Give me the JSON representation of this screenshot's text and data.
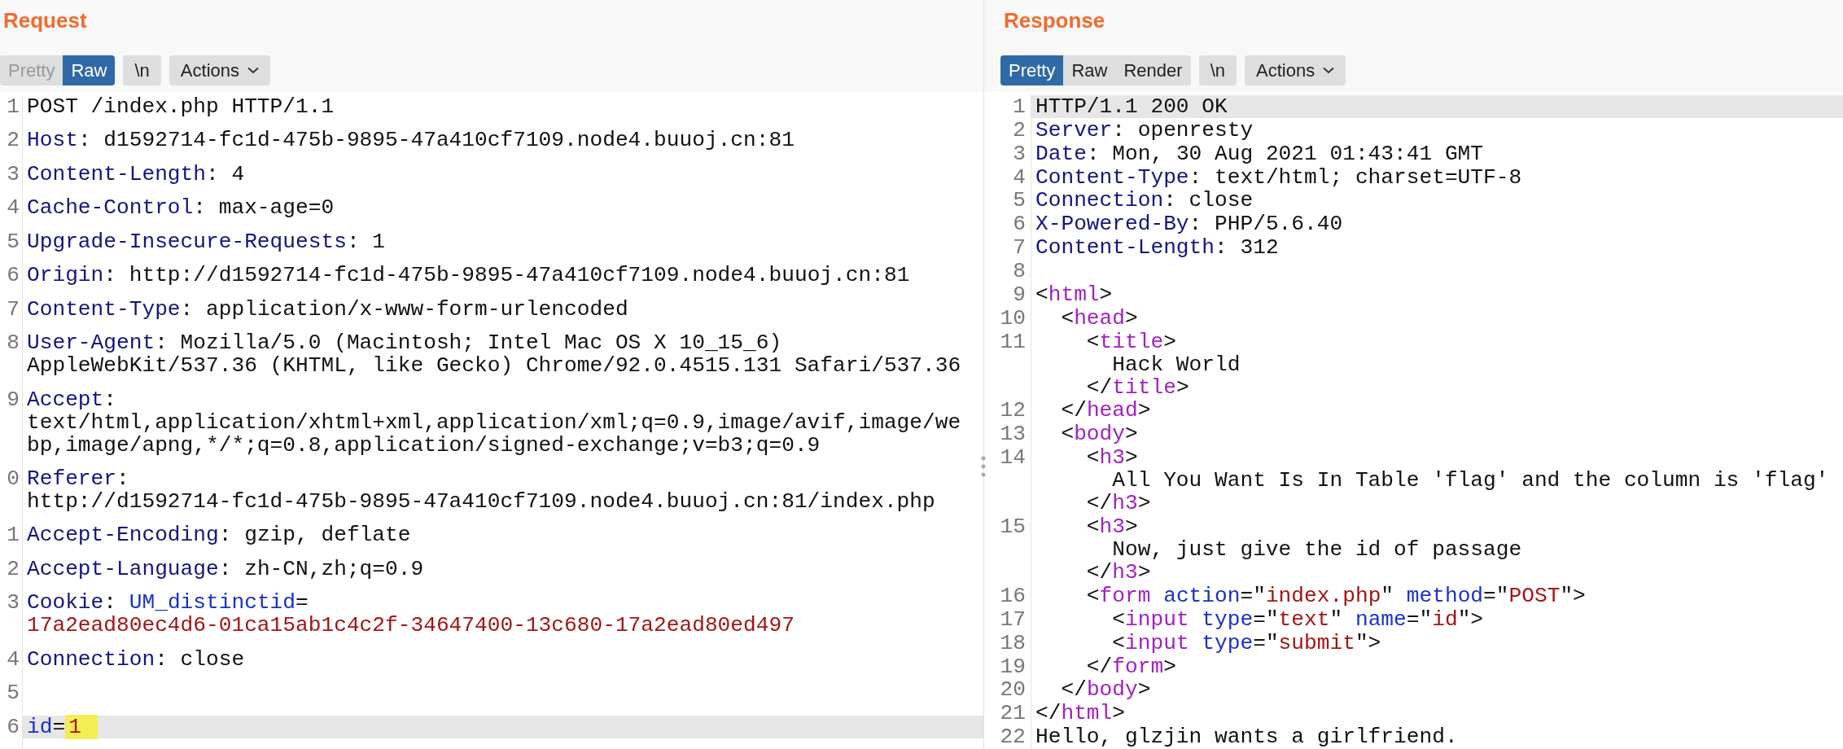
{
  "panels": [
    {
      "title": "Request",
      "view_tabs": [
        {
          "label": "Pretty",
          "selected": false
        },
        {
          "label": "Raw",
          "selected": true
        }
      ],
      "newline_button": "\\n",
      "actions_button": "Actions",
      "lines": [
        {
          "number": "1",
          "current": false,
          "rows": [
            {
              "tokens": [
                {
                  "kind": "plain",
                  "text": "POST /index.php HTTP/1.1"
                }
              ]
            }
          ]
        },
        {
          "number": "2",
          "current": false,
          "rows": [
            {
              "tokens": [
                {
                  "kind": "key",
                  "text": "Host"
                },
                {
                  "kind": "plain",
                  "text": ": d1592714-fc1d-475b-9895-47a410cf7109.node4.buuoj.cn:81"
                }
              ]
            }
          ]
        },
        {
          "number": "3",
          "current": false,
          "rows": [
            {
              "tokens": [
                {
                  "kind": "key",
                  "text": "Content-Length"
                },
                {
                  "kind": "plain",
                  "text": ": 4"
                }
              ]
            }
          ]
        },
        {
          "number": "4",
          "current": false,
          "rows": [
            {
              "tokens": [
                {
                  "kind": "key",
                  "text": "Cache-Control"
                },
                {
                  "kind": "plain",
                  "text": ": max-age=0"
                }
              ]
            }
          ]
        },
        {
          "number": "5",
          "current": false,
          "rows": [
            {
              "tokens": [
                {
                  "kind": "key",
                  "text": "Upgrade-Insecure-Requests"
                },
                {
                  "kind": "plain",
                  "text": ": 1"
                }
              ]
            }
          ]
        },
        {
          "number": "6",
          "current": false,
          "rows": [
            {
              "tokens": [
                {
                  "kind": "key",
                  "text": "Origin"
                },
                {
                  "kind": "plain",
                  "text": ": http://d1592714-fc1d-475b-9895-47a410cf7109.node4.buuoj.cn:81"
                }
              ]
            }
          ]
        },
        {
          "number": "7",
          "current": false,
          "rows": [
            {
              "tokens": [
                {
                  "kind": "key",
                  "text": "Content-Type"
                },
                {
                  "kind": "plain",
                  "text": ": application/x-www-form-urlencoded"
                }
              ]
            }
          ]
        },
        {
          "number": "8",
          "current": false,
          "rows": [
            {
              "tokens": [
                {
                  "kind": "key",
                  "text": "User-Agent"
                },
                {
                  "kind": "plain",
                  "text": ": Mozilla/5.0 (Macintosh; Intel Mac OS X 10_15_6)"
                }
              ]
            },
            {
              "tokens": [
                {
                  "kind": "plain",
                  "text": "AppleWebKit/537.36 (KHTML, like Gecko) Chrome/92.0.4515.131 Safari/537.36"
                }
              ]
            }
          ]
        },
        {
          "number": "9",
          "current": false,
          "rows": [
            {
              "tokens": [
                {
                  "kind": "key",
                  "text": "Accept"
                },
                {
                  "kind": "plain",
                  "text": ":"
                }
              ]
            },
            {
              "tokens": [
                {
                  "kind": "plain",
                  "text": "text/html,application/xhtml+xml,application/xml;q=0.9,image/avif,image/we"
                }
              ]
            },
            {
              "tokens": [
                {
                  "kind": "plain",
                  "text": "bp,image/apng,*/*;q=0.8,application/signed-exchange;v=b3;q=0.9"
                }
              ]
            }
          ]
        },
        {
          "number": "0",
          "current": false,
          "rows": [
            {
              "tokens": [
                {
                  "kind": "key",
                  "text": "Referer"
                },
                {
                  "kind": "plain",
                  "text": ":"
                }
              ]
            },
            {
              "tokens": [
                {
                  "kind": "plain",
                  "text": "http://d1592714-fc1d-475b-9895-47a410cf7109.node4.buuoj.cn:81/index.php"
                }
              ]
            }
          ]
        },
        {
          "number": "1",
          "current": false,
          "rows": [
            {
              "tokens": [
                {
                  "kind": "key",
                  "text": "Accept-Encoding"
                },
                {
                  "kind": "plain",
                  "text": ": gzip, deflate"
                }
              ]
            }
          ]
        },
        {
          "number": "2",
          "current": false,
          "rows": [
            {
              "tokens": [
                {
                  "kind": "key",
                  "text": "Accept-Language"
                },
                {
                  "kind": "plain",
                  "text": ": zh-CN,zh;q=0.9"
                }
              ]
            }
          ]
        },
        {
          "number": "3",
          "current": false,
          "rows": [
            {
              "tokens": [
                {
                  "kind": "key",
                  "text": "Cookie"
                },
                {
                  "kind": "plain",
                  "text": ": "
                },
                {
                  "kind": "attr",
                  "text": "UM_distinctid"
                },
                {
                  "kind": "plain",
                  "text": "="
                }
              ]
            },
            {
              "tokens": [
                {
                  "kind": "string",
                  "text": "17a2ead80ec4d6-01ca15ab1c4c2f-34647400-13c680-17a2ead80ed497"
                }
              ]
            }
          ]
        },
        {
          "number": "4",
          "current": false,
          "rows": [
            {
              "tokens": [
                {
                  "kind": "key",
                  "text": "Connection"
                },
                {
                  "kind": "plain",
                  "text": ": close"
                }
              ]
            }
          ]
        },
        {
          "number": "5",
          "current": false,
          "rows": [
            {}
          ]
        },
        {
          "number": "6",
          "current": true,
          "rows": [
            {
              "tokens": [
                {
                  "kind": "attr",
                  "text": "id"
                },
                {
                  "kind": "plain",
                  "text": "="
                },
                {
                  "kind": "string",
                  "text": "1",
                  "highlighted": true
                }
              ]
            }
          ]
        }
      ]
    },
    {
      "title": "Response",
      "view_tabs": [
        {
          "label": "Pretty",
          "selected": true
        },
        {
          "label": "Raw",
          "selected": false
        },
        {
          "label": "Render",
          "selected": false
        }
      ],
      "newline_button": "\\n",
      "actions_button": "Actions",
      "lines": [
        {
          "number": "1",
          "current": true,
          "rows": [
            {
              "tokens": [
                {
                  "kind": "plain",
                  "text": "HTTP/1.1 200 OK"
                }
              ]
            }
          ]
        },
        {
          "number": "2",
          "current": false,
          "rows": [
            {
              "tokens": [
                {
                  "kind": "key",
                  "text": "Server"
                },
                {
                  "kind": "plain",
                  "text": ": openresty"
                }
              ]
            }
          ]
        },
        {
          "number": "3",
          "current": false,
          "rows": [
            {
              "tokens": [
                {
                  "kind": "key",
                  "text": "Date"
                },
                {
                  "kind": "plain",
                  "text": ": Mon, 30 Aug 2021 01:43:41 GMT"
                }
              ]
            }
          ]
        },
        {
          "number": "4",
          "current": false,
          "rows": [
            {
              "tokens": [
                {
                  "kind": "key",
                  "text": "Content-Type"
                },
                {
                  "kind": "plain",
                  "text": ": text/html; charset=UTF-8"
                }
              ]
            }
          ]
        },
        {
          "number": "5",
          "current": false,
          "rows": [
            {
              "tokens": [
                {
                  "kind": "key",
                  "text": "Connection"
                },
                {
                  "kind": "plain",
                  "text": ": close"
                }
              ]
            }
          ]
        },
        {
          "number": "6",
          "current": false,
          "rows": [
            {
              "tokens": [
                {
                  "kind": "key",
                  "text": "X-Powered-By"
                },
                {
                  "kind": "plain",
                  "text": ": PHP/5.6.40"
                }
              ]
            }
          ]
        },
        {
          "number": "7",
          "current": false,
          "rows": [
            {
              "tokens": [
                {
                  "kind": "key",
                  "text": "Content-Length"
                },
                {
                  "kind": "plain",
                  "text": ": 312"
                }
              ]
            }
          ]
        },
        {
          "number": "8",
          "current": false,
          "rows": [
            {}
          ]
        },
        {
          "number": "9",
          "current": false,
          "rows": [
            {
              "tokens": [
                {
                  "kind": "plain",
                  "text": "<"
                },
                {
                  "kind": "tag",
                  "text": "html"
                },
                {
                  "kind": "plain",
                  "text": ">"
                }
              ]
            }
          ]
        },
        {
          "number": "10",
          "current": false,
          "rows": [
            {
              "tokens": [
                {
                  "kind": "plain",
                  "text": "  <"
                },
                {
                  "kind": "tag",
                  "text": "head"
                },
                {
                  "kind": "plain",
                  "text": ">"
                }
              ]
            }
          ]
        },
        {
          "number": "11",
          "current": false,
          "rows": [
            {
              "tokens": [
                {
                  "kind": "plain",
                  "text": "    <"
                },
                {
                  "kind": "tag",
                  "text": "title"
                },
                {
                  "kind": "plain",
                  "text": ">"
                }
              ]
            },
            {
              "tokens": [
                {
                  "kind": "plain",
                  "text": "      Hack World"
                }
              ]
            },
            {
              "tokens": [
                {
                  "kind": "plain",
                  "text": "    </"
                },
                {
                  "kind": "tag",
                  "text": "title"
                },
                {
                  "kind": "plain",
                  "text": ">"
                }
              ]
            }
          ]
        },
        {
          "number": "12",
          "current": false,
          "rows": [
            {
              "tokens": [
                {
                  "kind": "plain",
                  "text": "  </"
                },
                {
                  "kind": "tag",
                  "text": "head"
                },
                {
                  "kind": "plain",
                  "text": ">"
                }
              ]
            }
          ]
        },
        {
          "number": "13",
          "current": false,
          "rows": [
            {
              "tokens": [
                {
                  "kind": "plain",
                  "text": "  <"
                },
                {
                  "kind": "tag",
                  "text": "body"
                },
                {
                  "kind": "plain",
                  "text": ">"
                }
              ]
            }
          ]
        },
        {
          "number": "14",
          "current": false,
          "rows": [
            {
              "tokens": [
                {
                  "kind": "plain",
                  "text": "    <"
                },
                {
                  "kind": "tag",
                  "text": "h3"
                },
                {
                  "kind": "plain",
                  "text": ">"
                }
              ]
            },
            {
              "tokens": [
                {
                  "kind": "plain",
                  "text": "      All You Want Is In Table 'flag' and the column is 'flag'"
                }
              ]
            },
            {
              "tokens": [
                {
                  "kind": "plain",
                  "text": "    </"
                },
                {
                  "kind": "tag",
                  "text": "h3"
                },
                {
                  "kind": "plain",
                  "text": ">"
                }
              ]
            }
          ]
        },
        {
          "number": "15",
          "current": false,
          "rows": [
            {
              "tokens": [
                {
                  "kind": "plain",
                  "text": "    <"
                },
                {
                  "kind": "tag",
                  "text": "h3"
                },
                {
                  "kind": "plain",
                  "text": ">"
                }
              ]
            },
            {
              "tokens": [
                {
                  "kind": "plain",
                  "text": "      Now, just give the id of passage"
                }
              ]
            },
            {
              "tokens": [
                {
                  "kind": "plain",
                  "text": "    </"
                },
                {
                  "kind": "tag",
                  "text": "h3"
                },
                {
                  "kind": "plain",
                  "text": ">"
                }
              ]
            }
          ]
        },
        {
          "number": "16",
          "current": false,
          "rows": [
            {
              "tokens": [
                {
                  "kind": "plain",
                  "text": "    <"
                },
                {
                  "kind": "tag",
                  "text": "form"
                },
                {
                  "kind": "attr",
                  "text": " action"
                },
                {
                  "kind": "plain",
                  "text": "=\""
                },
                {
                  "kind": "string",
                  "text": "index.php"
                },
                {
                  "kind": "plain",
                  "text": "\""
                },
                {
                  "kind": "attr",
                  "text": " method"
                },
                {
                  "kind": "plain",
                  "text": "=\""
                },
                {
                  "kind": "string",
                  "text": "POST"
                },
                {
                  "kind": "plain",
                  "text": "\">"
                }
              ]
            }
          ]
        },
        {
          "number": "17",
          "current": false,
          "rows": [
            {
              "tokens": [
                {
                  "kind": "plain",
                  "text": "      <"
                },
                {
                  "kind": "tag",
                  "text": "input"
                },
                {
                  "kind": "attr",
                  "text": " type"
                },
                {
                  "kind": "plain",
                  "text": "=\""
                },
                {
                  "kind": "string",
                  "text": "text"
                },
                {
                  "kind": "plain",
                  "text": "\""
                },
                {
                  "kind": "attr",
                  "text": " name"
                },
                {
                  "kind": "plain",
                  "text": "=\""
                },
                {
                  "kind": "string",
                  "text": "id"
                },
                {
                  "kind": "plain",
                  "text": "\">"
                }
              ]
            }
          ]
        },
        {
          "number": "18",
          "current": false,
          "rows": [
            {
              "tokens": [
                {
                  "kind": "plain",
                  "text": "      <"
                },
                {
                  "kind": "tag",
                  "text": "input"
                },
                {
                  "kind": "attr",
                  "text": " type"
                },
                {
                  "kind": "plain",
                  "text": "=\""
                },
                {
                  "kind": "string",
                  "text": "submit"
                },
                {
                  "kind": "plain",
                  "text": "\">"
                }
              ]
            }
          ]
        },
        {
          "number": "19",
          "current": false,
          "rows": [
            {
              "tokens": [
                {
                  "kind": "plain",
                  "text": "    </"
                },
                {
                  "kind": "tag",
                  "text": "form"
                },
                {
                  "kind": "plain",
                  "text": ">"
                }
              ]
            }
          ]
        },
        {
          "number": "20",
          "current": false,
          "rows": [
            {
              "tokens": [
                {
                  "kind": "plain",
                  "text": "  </"
                },
                {
                  "kind": "tag",
                  "text": "body"
                },
                {
                  "kind": "plain",
                  "text": ">"
                }
              ]
            }
          ]
        },
        {
          "number": "21",
          "current": false,
          "rows": [
            {
              "tokens": [
                {
                  "kind": "plain",
                  "text": "</"
                },
                {
                  "kind": "tag",
                  "text": "html"
                },
                {
                  "kind": "plain",
                  "text": ">"
                }
              ]
            }
          ]
        },
        {
          "number": "22",
          "current": false,
          "rows": [
            {
              "tokens": [
                {
                  "kind": "plain",
                  "text": "Hello, glzjin wants a girlfriend."
                }
              ]
            }
          ]
        }
      ]
    }
  ]
}
